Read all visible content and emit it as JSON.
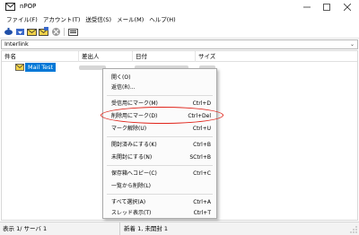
{
  "window": {
    "title": "nPOP"
  },
  "menubar": {
    "items": [
      "ファイル(F)",
      "アカウント(T)",
      "送受信(S)",
      "メール(M)",
      "ヘルプ(H)"
    ]
  },
  "toolbar": {
    "icons": [
      "check-new-mail-icon",
      "send-receive-icon",
      "compose-icon",
      "reply-icon",
      "stop-icon",
      "address-book-icon"
    ]
  },
  "account": {
    "selected": "Interlink"
  },
  "list": {
    "columns": [
      "件名",
      "差出人",
      "日付",
      "サイズ"
    ],
    "rows": [
      {
        "subject": "Mail Test"
      }
    ]
  },
  "context_menu": {
    "items": [
      {
        "label": "開く(O)",
        "shortcut": ""
      },
      {
        "label": "返信(R)...",
        "shortcut": ""
      },
      {
        "label": "受信用にマーク(M)",
        "shortcut": "Ctrl+D"
      },
      {
        "label": "削除用にマーク(D)",
        "shortcut": "Ctrl+Del"
      },
      {
        "label": "マーク解除(U)",
        "shortcut": "Ctrl+U"
      },
      {
        "label": "開封済みにする(K)",
        "shortcut": "Ctrl+B"
      },
      {
        "label": "未開封にする(N)",
        "shortcut": "SCtrl+B"
      },
      {
        "label": "保存箱へコピー(C)",
        "shortcut": "Ctrl+C"
      },
      {
        "label": "一覧から削除(L)",
        "shortcut": ""
      },
      {
        "label": "すべて選択(A)",
        "shortcut": "Ctrl+A"
      },
      {
        "label": "スレッド表示(T)",
        "shortcut": "Ctrl+T"
      }
    ]
  },
  "status": {
    "left": "表示 1/ サーバ 1",
    "mid": "新着 1, 未開封 1"
  },
  "colors": {
    "selection": "#0078d7",
    "highlight_ellipse": "#e0241a"
  }
}
